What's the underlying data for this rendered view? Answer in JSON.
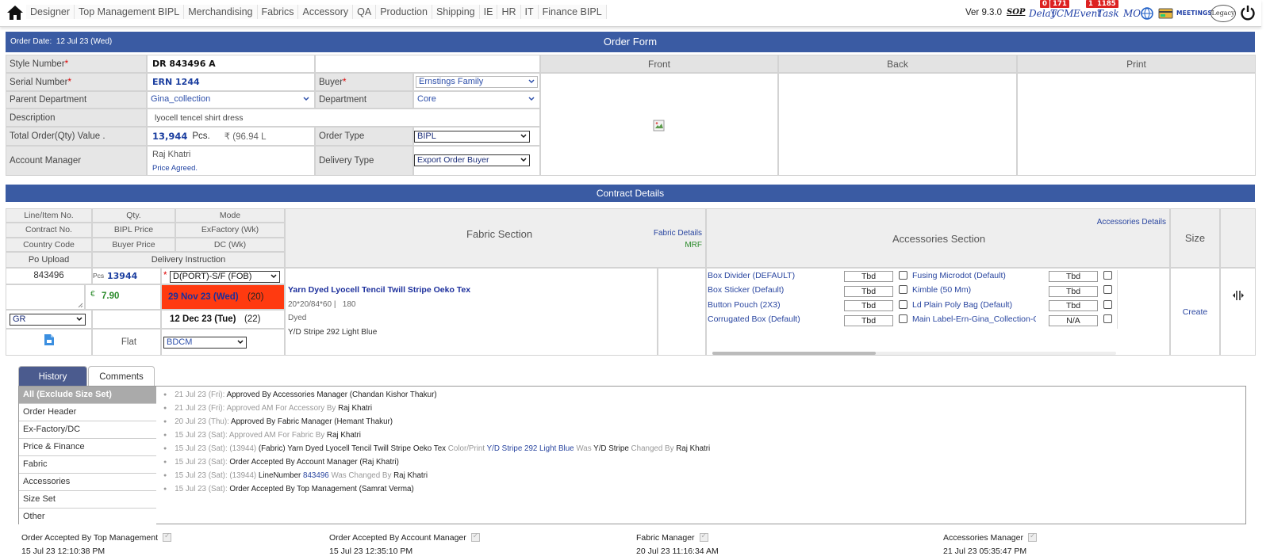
{
  "nav": {
    "menu": [
      "Designer",
      "Top Management BIPL",
      "Merchandising",
      "Fabrics",
      "Accessory",
      "QA",
      "Production",
      "Shipping",
      "IE",
      "HR",
      "IT",
      "Finance BIPL"
    ],
    "version": "Ver 9.3.0",
    "sop": "SOP",
    "delay_label": "Delay",
    "delay_badge": "0",
    "tcm_label": "TCM",
    "tcm_badge": "171",
    "event_label": "Event",
    "event_badge": "1",
    "task_label": "Task",
    "task_badge": "1185",
    "mo_label": "MO",
    "meetings_label": "MEETINGS",
    "legacy_label": "Legacy"
  },
  "order": {
    "date_label": "Order Date:",
    "date_value": "12 Jul 23 (Wed)",
    "title": "Order Form",
    "style_number_label": "Style Number",
    "style_number": "DR 843496 A",
    "serial_number_label": "Serial Number",
    "serial_number": "ERN 1244",
    "buyer_label": "Buyer",
    "buyer": "Ernstings Family",
    "parent_department_label": "Parent Department",
    "parent_department": "Gina_collection",
    "department_label": "Department",
    "department": "Core",
    "description_label": "Description",
    "description": "lyocell tencel shirt dress",
    "total_label": "Total Order(Qty) Value .",
    "total_qty": "13,944",
    "total_unit": "Pcs.",
    "total_value": "₹ (96.94 L",
    "order_type_label": "Order Type",
    "order_type": "BIPL",
    "account_manager_label": "Account Manager",
    "account_manager": "Raj Khatri",
    "price_status": "Price Agreed.",
    "delivery_type_label": "Delivery Type",
    "delivery_type": "Export Order Buyer",
    "front_label": "Front",
    "back_label": "Back",
    "print_label": "Print"
  },
  "contract": {
    "title": "Contract Details",
    "headers": {
      "line_item": "Line/Item No.",
      "qty": "Qty.",
      "mode": "Mode",
      "contract_no": "Contract No.",
      "bipl_price": "BIPL Price",
      "exfactory": "ExFactory (Wk)",
      "country_code": "Country Code",
      "buyer_price": "Buyer Price",
      "dc": "DC (Wk)",
      "po_upload": "Po Upload",
      "delivery_instruction": "Delivery Instruction",
      "fabric_section": "Fabric Section",
      "fabric_details": "Fabric Details",
      "mrf": "MRF",
      "accessories_section": "Accessories Section",
      "accessories_details": "Accessories Details",
      "size": "Size"
    },
    "row": {
      "line_no": "843496",
      "pcs_label": "Pcs",
      "qty": "13944",
      "mode_required": "*",
      "mode": "D(PORT)-S/F (FOB)",
      "currency": "€",
      "bipl_price": "7.90",
      "exfactory_date": "29 Nov 23 (Wed)",
      "exfactory_wk": "(20)",
      "country": "GR",
      "dc_date": "12 Dec 23 (Tue)",
      "dc_wk": "(22)",
      "delivery_instruction": "Flat",
      "delivery_select": "BDCM",
      "size_action": "Create"
    },
    "fabric": {
      "name": "Yarn Dyed Lyocell Tencil Twill Stripe Oeko Tex",
      "spec": "20*20/84*60 |",
      "gsm": "180",
      "process": "Dyed",
      "color": "Y/D Stripe 292 Light Blue"
    },
    "accessories_left": [
      {
        "name": "Box Divider (DEFAULT)",
        "qty": "Tbd"
      },
      {
        "name": "Box Sticker (Default)",
        "qty": "Tbd"
      },
      {
        "name": "Button Pouch (2X3)",
        "qty": "Tbd"
      },
      {
        "name": "Corrugated Box (Default)",
        "qty": "Tbd"
      }
    ],
    "accessories_right": [
      {
        "name": "Fusing Microdot (Default)",
        "qty": "Tbd"
      },
      {
        "name": "Kimble (50 Mm)",
        "qty": "Tbd"
      },
      {
        "name": "Ld Plain Poly Bag (Default)",
        "qty": "Tbd"
      },
      {
        "name": "Main Label-Ern-Gina_Collection-C",
        "qty": "N/A"
      }
    ]
  },
  "history": {
    "tab_history": "History",
    "tab_comments": "Comments",
    "sidebar": [
      "All (Exclude Size Set)",
      "Order Header",
      "Ex-Factory/DC",
      "Price & Finance",
      "Fabric",
      "Accessories",
      "Size Set",
      "Other"
    ],
    "entries": [
      {
        "date": "21 Jul 23 (Fri):",
        "text": "Approved By Accessories Manager (Chandan Kishor Thakur)"
      },
      {
        "date": "21 Jul 23 (Fri):",
        "pre": "Approved AM For Accessory By",
        "text": "Raj Khatri"
      },
      {
        "date": "20 Jul 23 (Thu):",
        "text": "Approved By Fabric Manager (Hemant Thakur)"
      },
      {
        "date": "15 Jul 23 (Sat):",
        "pre": "Approved AM For Fabric By",
        "text": "Raj Khatri"
      },
      {
        "date": "15 Jul 23 (Sat):",
        "qty": "(13944)",
        "text": "(Fabric) Yarn Dyed Lyocell Tencil Twill Stripe Oeko Tex",
        "k1": "Color/Print",
        "v1": "Y/D Stripe 292 Light Blue",
        "k2": "Was",
        "v2": "Y/D Stripe",
        "k3": "Changed By",
        "v3": "Raj Khatri"
      },
      {
        "date": "15 Jul 23 (Sat):",
        "text": "Order Accepted By Account Manager (Raj Khatri)"
      },
      {
        "date": "15 Jul 23 (Sat):",
        "qty": "(13944)",
        "text": "LineNumber",
        "v1": "843496",
        "k2": "Was Changed By",
        "v3": "Raj Khatri"
      },
      {
        "date": "15 Jul 23 (Sat):",
        "text": "Order Accepted By Top Management (Samrat Verma)"
      }
    ]
  },
  "approvals": [
    {
      "label": "Order Accepted By Top Management",
      "time": "15 Jul 23 12:10:38 PM"
    },
    {
      "label": "Order Accepted By Account Manager",
      "time": "15 Jul 23 12:35:10 PM"
    },
    {
      "label": "Fabric Manager",
      "time": "20 Jul 23 11:16:34 AM"
    },
    {
      "label": "Accessories Manager",
      "time": "21 Jul 23 05:35:47 PM"
    }
  ],
  "colors": {
    "header_blue": "#3a5ba3",
    "exfactory_bg": "#ff3a10",
    "link_blue": "#2a46a0",
    "badge_red": "#dd2222"
  }
}
